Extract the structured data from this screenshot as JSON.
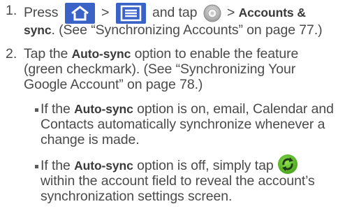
{
  "steps": [
    {
      "number": "1.",
      "line1": {
        "press": "Press",
        "gt1": ">",
        "and_tap": "and tap",
        "gt2": ">",
        "bold1": "Accounts &"
      },
      "line2": {
        "bold2": "sync",
        "rest": ". (See “Synchronizing Accounts” on page 77.)"
      }
    },
    {
      "number": "2.",
      "line1": {
        "pre": "Tap the ",
        "bold": "Auto-sync",
        "post": " option to enable the feature"
      },
      "line2": "(green checkmark). (See “Synchronizing Your",
      "line3": "Google Account” on page 78.)"
    }
  ],
  "bullets": [
    {
      "line1": {
        "pre": "If the ",
        "bold": "Auto-sync",
        "post": " option is on, email, Calendar and"
      },
      "line2": "Contacts automatically synchronize whenever a",
      "line3": "change is made."
    },
    {
      "line1": {
        "pre": "If the ",
        "bold": "Auto-sync",
        "post": " option is off, simply tap "
      },
      "line2": "within the account field to reveal the account’s",
      "line3": "synchronization settings screen."
    }
  ],
  "icons": {
    "home": "home-icon",
    "menu": "menu-icon",
    "settings": "settings-gear-icon",
    "sync": "sync-icon"
  },
  "colors": {
    "text": "#4a4a4a",
    "icon_blue": "#3b63c7",
    "sync_green": "#6cc43c"
  }
}
